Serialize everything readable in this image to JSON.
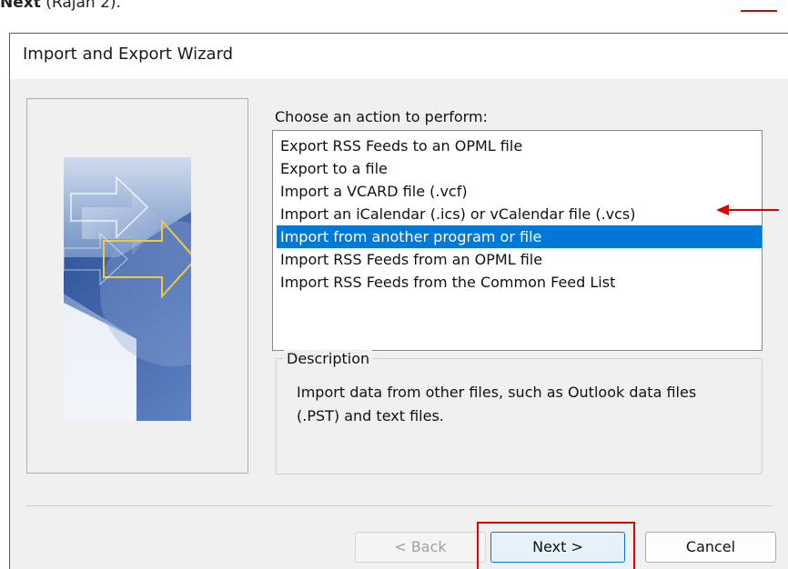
{
  "caption": {
    "bold_text": "Next",
    "rest_text": " (Rajah 2)."
  },
  "dialog": {
    "title": "Import and Export Wizard",
    "prompt": "Choose an action to perform:",
    "actions": [
      "Export RSS Feeds to an OPML file",
      "Export to a file",
      "Import a VCARD file (.vcf)",
      "Import an iCalendar (.ics) or vCalendar file (.vcs)",
      "Import from another program or file",
      "Import RSS Feeds from an OPML file",
      "Import RSS Feeds from the Common Feed List"
    ],
    "selected_action": "Import from another program or file",
    "description_label": "Description",
    "description_text": "Import data from other files, such as Outlook data files (.PST) and text files.",
    "buttons": {
      "back": "< Back",
      "next": "Next >",
      "cancel": "Cancel"
    }
  },
  "colors": {
    "selection": "#0078d7",
    "annotation": "#e00000"
  }
}
